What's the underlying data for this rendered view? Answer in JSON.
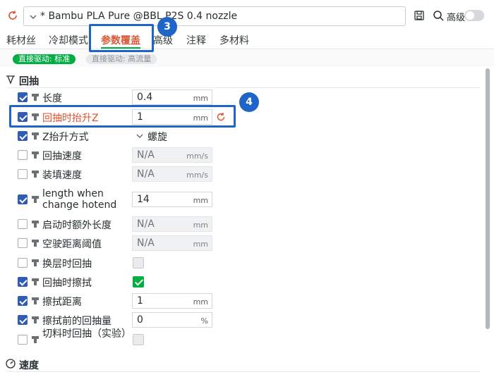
{
  "header": {
    "preset": "* Bambu PLA Pure @BBL P2S 0.4 nozzle",
    "advanced_label": "高级"
  },
  "tabs": [
    {
      "label": "耗材丝",
      "active": false
    },
    {
      "label": "冷却模式",
      "active": false
    },
    {
      "label": "参数覆盖",
      "active": true
    },
    {
      "label": "高级",
      "active": false
    },
    {
      "label": "注释",
      "active": false
    },
    {
      "label": "多材料",
      "active": false
    }
  ],
  "extruder_pills": [
    {
      "label": "直接驱动: 标准",
      "active": true
    },
    {
      "label": "直接驱动: 高流量",
      "active": false
    }
  ],
  "sections": {
    "retraction": "回抽",
    "speed": "速度"
  },
  "rows": [
    {
      "label": "长度",
      "checked": true,
      "type": "number",
      "value": "0.4",
      "unit": "mm"
    },
    {
      "label": "回抽时抬升Z",
      "checked": true,
      "type": "number",
      "value": "1",
      "unit": "mm",
      "modified": true
    },
    {
      "label": "Z抬升方式",
      "checked": true,
      "type": "dropdown",
      "value": "螺旋"
    },
    {
      "label": "回抽速度",
      "checked": false,
      "type": "number",
      "value": "N/A",
      "unit": "mm/s"
    },
    {
      "label": "装填速度",
      "checked": false,
      "type": "number",
      "value": "N/A",
      "unit": "mm/s"
    },
    {
      "label": "length when change hotend",
      "checked": true,
      "type": "number",
      "value": "14",
      "unit": "mm"
    },
    {
      "label": "启动时额外长度",
      "checked": false,
      "type": "number",
      "value": "N/A",
      "unit": "mm"
    },
    {
      "label": "空驶距离阈值",
      "checked": false,
      "type": "number",
      "value": "N/A",
      "unit": "mm"
    },
    {
      "label": "换层时回抽",
      "checked": false,
      "type": "bool",
      "value": false
    },
    {
      "label": "回抽时擦拭",
      "checked": true,
      "type": "bool",
      "value": true
    },
    {
      "label": "擦拭距离",
      "checked": true,
      "type": "number",
      "value": "1",
      "unit": "mm"
    },
    {
      "label": "擦拭前的回抽量",
      "checked": true,
      "type": "number",
      "value": "0",
      "unit": "%"
    },
    {
      "label": "切料时回抽（实验）",
      "checked": false,
      "type": "bool",
      "value": false
    }
  ],
  "annotations": {
    "badge_tab": "3",
    "badge_row": "4"
  },
  "colors": {
    "accent_green": "#00ae42",
    "modified_orange": "#e2502c",
    "checkbox_blue": "#2f5db6",
    "highlight_blue": "#1f64c8"
  }
}
